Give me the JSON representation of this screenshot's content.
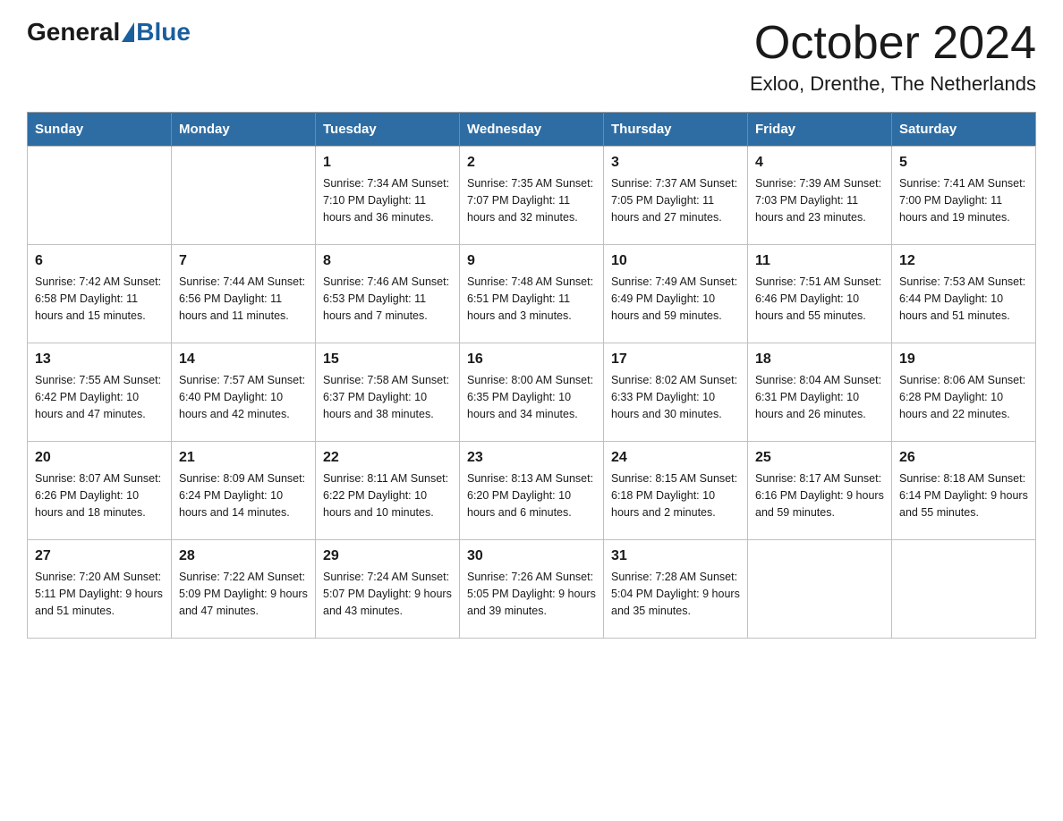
{
  "logo": {
    "general": "General",
    "blue": "Blue"
  },
  "title": "October 2024",
  "subtitle": "Exloo, Drenthe, The Netherlands",
  "weekdays": [
    "Sunday",
    "Monday",
    "Tuesday",
    "Wednesday",
    "Thursday",
    "Friday",
    "Saturday"
  ],
  "weeks": [
    [
      {
        "day": "",
        "info": ""
      },
      {
        "day": "",
        "info": ""
      },
      {
        "day": "1",
        "info": "Sunrise: 7:34 AM\nSunset: 7:10 PM\nDaylight: 11 hours\nand 36 minutes."
      },
      {
        "day": "2",
        "info": "Sunrise: 7:35 AM\nSunset: 7:07 PM\nDaylight: 11 hours\nand 32 minutes."
      },
      {
        "day": "3",
        "info": "Sunrise: 7:37 AM\nSunset: 7:05 PM\nDaylight: 11 hours\nand 27 minutes."
      },
      {
        "day": "4",
        "info": "Sunrise: 7:39 AM\nSunset: 7:03 PM\nDaylight: 11 hours\nand 23 minutes."
      },
      {
        "day": "5",
        "info": "Sunrise: 7:41 AM\nSunset: 7:00 PM\nDaylight: 11 hours\nand 19 minutes."
      }
    ],
    [
      {
        "day": "6",
        "info": "Sunrise: 7:42 AM\nSunset: 6:58 PM\nDaylight: 11 hours\nand 15 minutes."
      },
      {
        "day": "7",
        "info": "Sunrise: 7:44 AM\nSunset: 6:56 PM\nDaylight: 11 hours\nand 11 minutes."
      },
      {
        "day": "8",
        "info": "Sunrise: 7:46 AM\nSunset: 6:53 PM\nDaylight: 11 hours\nand 7 minutes."
      },
      {
        "day": "9",
        "info": "Sunrise: 7:48 AM\nSunset: 6:51 PM\nDaylight: 11 hours\nand 3 minutes."
      },
      {
        "day": "10",
        "info": "Sunrise: 7:49 AM\nSunset: 6:49 PM\nDaylight: 10 hours\nand 59 minutes."
      },
      {
        "day": "11",
        "info": "Sunrise: 7:51 AM\nSunset: 6:46 PM\nDaylight: 10 hours\nand 55 minutes."
      },
      {
        "day": "12",
        "info": "Sunrise: 7:53 AM\nSunset: 6:44 PM\nDaylight: 10 hours\nand 51 minutes."
      }
    ],
    [
      {
        "day": "13",
        "info": "Sunrise: 7:55 AM\nSunset: 6:42 PM\nDaylight: 10 hours\nand 47 minutes."
      },
      {
        "day": "14",
        "info": "Sunrise: 7:57 AM\nSunset: 6:40 PM\nDaylight: 10 hours\nand 42 minutes."
      },
      {
        "day": "15",
        "info": "Sunrise: 7:58 AM\nSunset: 6:37 PM\nDaylight: 10 hours\nand 38 minutes."
      },
      {
        "day": "16",
        "info": "Sunrise: 8:00 AM\nSunset: 6:35 PM\nDaylight: 10 hours\nand 34 minutes."
      },
      {
        "day": "17",
        "info": "Sunrise: 8:02 AM\nSunset: 6:33 PM\nDaylight: 10 hours\nand 30 minutes."
      },
      {
        "day": "18",
        "info": "Sunrise: 8:04 AM\nSunset: 6:31 PM\nDaylight: 10 hours\nand 26 minutes."
      },
      {
        "day": "19",
        "info": "Sunrise: 8:06 AM\nSunset: 6:28 PM\nDaylight: 10 hours\nand 22 minutes."
      }
    ],
    [
      {
        "day": "20",
        "info": "Sunrise: 8:07 AM\nSunset: 6:26 PM\nDaylight: 10 hours\nand 18 minutes."
      },
      {
        "day": "21",
        "info": "Sunrise: 8:09 AM\nSunset: 6:24 PM\nDaylight: 10 hours\nand 14 minutes."
      },
      {
        "day": "22",
        "info": "Sunrise: 8:11 AM\nSunset: 6:22 PM\nDaylight: 10 hours\nand 10 minutes."
      },
      {
        "day": "23",
        "info": "Sunrise: 8:13 AM\nSunset: 6:20 PM\nDaylight: 10 hours\nand 6 minutes."
      },
      {
        "day": "24",
        "info": "Sunrise: 8:15 AM\nSunset: 6:18 PM\nDaylight: 10 hours\nand 2 minutes."
      },
      {
        "day": "25",
        "info": "Sunrise: 8:17 AM\nSunset: 6:16 PM\nDaylight: 9 hours\nand 59 minutes."
      },
      {
        "day": "26",
        "info": "Sunrise: 8:18 AM\nSunset: 6:14 PM\nDaylight: 9 hours\nand 55 minutes."
      }
    ],
    [
      {
        "day": "27",
        "info": "Sunrise: 7:20 AM\nSunset: 5:11 PM\nDaylight: 9 hours\nand 51 minutes."
      },
      {
        "day": "28",
        "info": "Sunrise: 7:22 AM\nSunset: 5:09 PM\nDaylight: 9 hours\nand 47 minutes."
      },
      {
        "day": "29",
        "info": "Sunrise: 7:24 AM\nSunset: 5:07 PM\nDaylight: 9 hours\nand 43 minutes."
      },
      {
        "day": "30",
        "info": "Sunrise: 7:26 AM\nSunset: 5:05 PM\nDaylight: 9 hours\nand 39 minutes."
      },
      {
        "day": "31",
        "info": "Sunrise: 7:28 AM\nSunset: 5:04 PM\nDaylight: 9 hours\nand 35 minutes."
      },
      {
        "day": "",
        "info": ""
      },
      {
        "day": "",
        "info": ""
      }
    ]
  ]
}
